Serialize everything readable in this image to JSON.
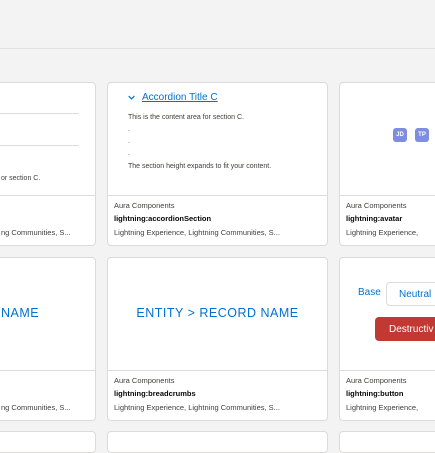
{
  "cards": [
    {
      "id": "left-top",
      "category": "",
      "name": "",
      "targets": "ng Communities, S...",
      "preview_lines": [
        "or section C."
      ]
    },
    {
      "id": "accordion",
      "category": "Aura Components",
      "name": "lightning:accordionSection",
      "targets": "Lightning Experience, Lightning Communities, S...",
      "accordion": {
        "title": "Accordion Title C",
        "lines": [
          "This is the content area for section C.",
          ".",
          ".",
          ".",
          "The section height expands to fit your content."
        ]
      }
    },
    {
      "id": "avatar",
      "category": "Aura Components",
      "name": "lightning:avatar",
      "targets": "Lightning Experience,",
      "avatars": [
        "JD",
        "TP"
      ]
    },
    {
      "id": "left-bottom",
      "category": "",
      "name": "",
      "targets": "ng Communities, S...",
      "preview_text": "NAME"
    },
    {
      "id": "breadcrumbs",
      "category": "Aura Components",
      "name": "lightning:breadcrumbs",
      "targets": "Lightning Experience, Lightning Communities, S...",
      "preview_text": "ENTITY > RECORD NAME"
    },
    {
      "id": "button",
      "category": "Aura Components",
      "name": "lightning:button",
      "targets": "Lightning Experience,",
      "buttons": {
        "base": "Base",
        "neutral": "Neutral",
        "destructive": "Destructiv"
      }
    }
  ]
}
